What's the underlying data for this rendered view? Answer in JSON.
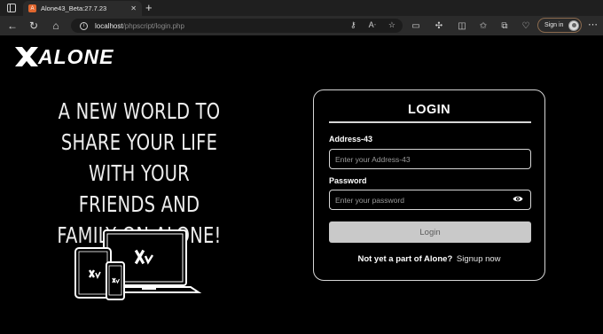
{
  "browser": {
    "tab_title": "Alone43_Beta:27.7.23",
    "tab_favicon_letter": "A",
    "url_host": "localhost",
    "url_path": "/phpscript/login.php",
    "signin_label": "Sign in"
  },
  "brand": {
    "name": "XALONE"
  },
  "tagline": "A NEW WORLD TO SHARE YOUR LIFE WITH YOUR FRIENDS AND FAMILY ON ALONE!",
  "login": {
    "title": "LOGIN",
    "address_label": "Address-43",
    "address_placeholder": "Enter your Address-43",
    "password_label": "Password",
    "password_placeholder": "Enter your password",
    "submit_label": "Login",
    "signup_prompt": "Not yet a part of Alone?",
    "signup_link": "Signup now"
  },
  "icons": {
    "window": "window-icon",
    "back": "back-arrow-icon",
    "refresh": "refresh-icon",
    "home": "home-icon",
    "info": "info-icon",
    "eye": "eye-icon"
  },
  "colors": {
    "background": "#000000",
    "card_border": "#d6d6d6",
    "button": "#c9c9c9",
    "chrome": "#2b2b2b"
  }
}
